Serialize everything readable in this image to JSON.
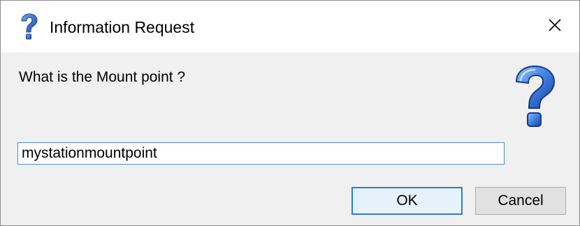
{
  "window": {
    "title": "Information Request",
    "title_icon": "question-icon",
    "close_icon": "close-icon"
  },
  "dialog": {
    "prompt": "What is the Mount point ?",
    "icon": "large-question-icon",
    "input": {
      "value": "mystationmountpoint",
      "placeholder": ""
    },
    "buttons": {
      "ok_label": "OK",
      "cancel_label": "Cancel"
    }
  },
  "colors": {
    "accent": "#2e7bd6",
    "icon_blue": "#2f67c8",
    "titlebar_bg": "#ffffff",
    "body_bg": "#f0f0f0"
  }
}
